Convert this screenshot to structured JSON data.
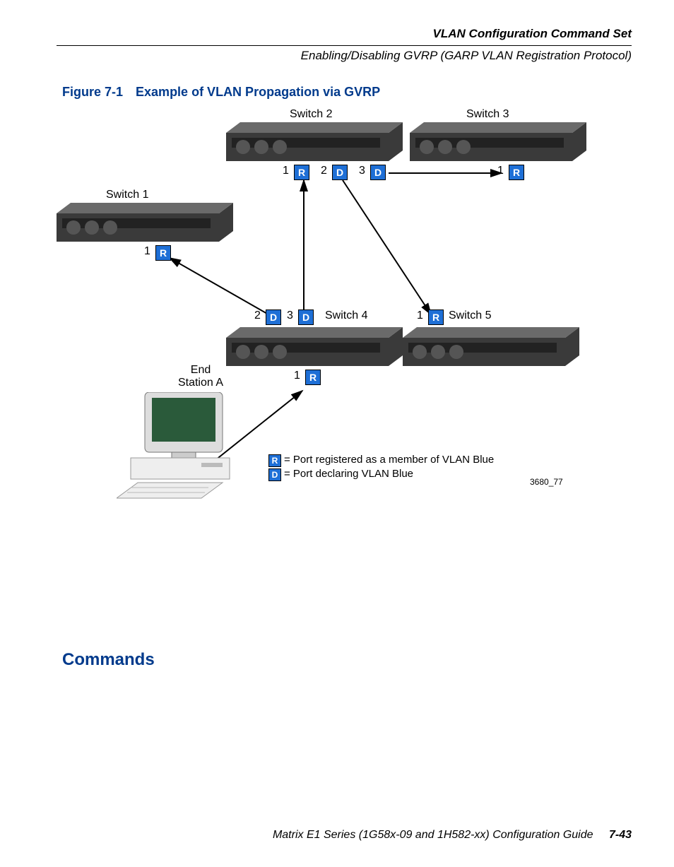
{
  "header": {
    "line1": "VLAN Configuration Command Set",
    "line2": "Enabling/Disabling GVRP (GARP VLAN Registration Protocol)"
  },
  "figure": {
    "caption_prefix": "Figure 7-1",
    "caption_title": "Example of VLAN Propagation via GVRP",
    "labels": {
      "switch1": "Switch 1",
      "switch2": "Switch 2",
      "switch3": "Switch 3",
      "switch4": "Switch 4",
      "switch5": "Switch 5",
      "endstation_l1": "End",
      "endstation_l2": "Station A"
    },
    "ports": {
      "sw1_p1": {
        "n": "1",
        "t": "R"
      },
      "sw2_p1": {
        "n": "1",
        "t": "R"
      },
      "sw2_p2": {
        "n": "2",
        "t": "D"
      },
      "sw2_p3": {
        "n": "3",
        "t": "D"
      },
      "sw3_p1": {
        "n": "1",
        "t": "R"
      },
      "sw4_p1": {
        "n": "1",
        "t": "R"
      },
      "sw4_p2": {
        "n": "2",
        "t": "D"
      },
      "sw4_p3": {
        "n": "3",
        "t": "D"
      },
      "sw5_p1": {
        "n": "1",
        "t": "R"
      }
    },
    "legend": {
      "r_key": "R",
      "r_text": "= Port registered as a member of VLAN Blue",
      "d_key": "D",
      "d_text": "= Port declaring VLAN Blue"
    },
    "fig_id": "3680_77"
  },
  "section": {
    "commands": "Commands"
  },
  "footer": {
    "text": "Matrix E1 Series (1G58x-09 and 1H582-xx) Configuration Guide",
    "page": "7-43"
  }
}
